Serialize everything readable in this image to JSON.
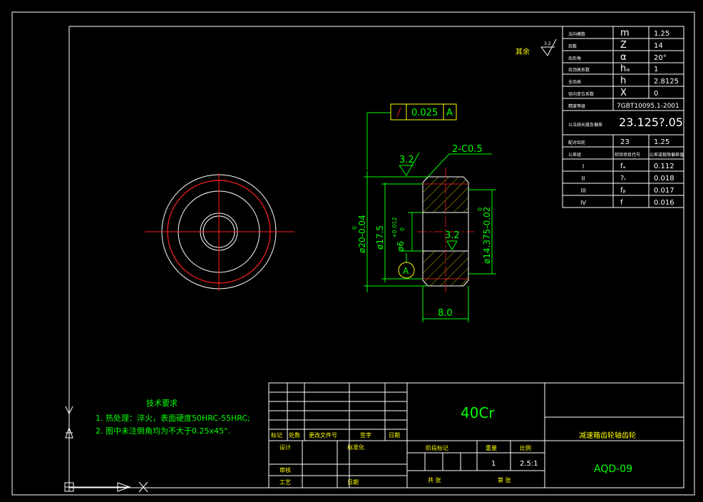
{
  "drawing": {
    "surface_note": "其余",
    "surface_symbol": "3.2",
    "runout_tolerance": "0.025",
    "runout_datum": "A",
    "chamfer_note": "2-C0.5",
    "roughness_top": "3.2",
    "roughness_bore": "3.2",
    "datum_label": "A",
    "dim_outer": "ø20-0.04",
    "dim_outer_upper": "0",
    "dim_d17": "ø17.5",
    "dim_bore": "ø6",
    "dim_bore_tol_upper": "+0.012",
    "dim_bore_tol_lower": "0",
    "dim_root": "ø14.375-0.02",
    "dim_root_upper": "0",
    "dim_width": "8.0"
  },
  "gear_params": {
    "rows": [
      {
        "name": "法向模数",
        "symbol": "m",
        "value": "1.25"
      },
      {
        "name": "齿数",
        "symbol": "Z",
        "value": "14"
      },
      {
        "name": "齿形角",
        "symbol": "α",
        "value": "20°"
      },
      {
        "name": "齿顶高系数",
        "symbol": "hₐ",
        "value": "1"
      },
      {
        "name": "全齿高",
        "symbol": "h",
        "value": "2.8125"
      },
      {
        "name": "径向变位系数",
        "symbol": "X",
        "value": "0"
      },
      {
        "name": "精度等级",
        "symbol": "",
        "value": "7GBT10095.1-2001"
      },
      {
        "name": "公法线长度及偏差",
        "symbol": "",
        "value": "23.125?.05"
      },
      {
        "name": "配对齿轮",
        "symbol": "23",
        "value": "1.25"
      },
      {
        "name": "公差组",
        "symbol": "检验项目代号",
        "value": "公差或极限偏差值"
      },
      {
        "name": "I",
        "symbol": "fₐ",
        "value": "0.112"
      },
      {
        "name": "II",
        "symbol": "?ᵣ",
        "value": "0.018"
      },
      {
        "name": "III",
        "symbol": "fᵦ",
        "value": "0.017"
      },
      {
        "name": "IV",
        "symbol": "f",
        "value": "0.016"
      }
    ]
  },
  "tech_requirements": {
    "title": "技术要求",
    "items": [
      "1. 热处理：淬火，表面硬度50HRC-55HRC;",
      "2. 图中未注倒角均为不大于0.25x45°."
    ]
  },
  "title_block": {
    "material": "40Cr",
    "part_name": "减速箱齿轮轴齿轮",
    "drawing_no": "AQD-09",
    "mark_label": "标记",
    "count_label": "处数",
    "change_doc_label": "更改文件号",
    "sign_label": "签字",
    "date_label": "日期",
    "design_label": "设计",
    "standardize_label": "标准化",
    "review_label": "审核",
    "process_label": "工艺",
    "approve_label": "日期",
    "stage_mark_label": "阶段标记",
    "weight_label": "重量",
    "scale_label": "比例",
    "weight_value": "1",
    "scale_value": "2.5:1",
    "total_sheets_label": "共  张",
    "sheet_label": "第  张"
  },
  "colors": {
    "background": "#000000",
    "line": "#ffffff",
    "center": "#ff0000",
    "dim": "#00ff00",
    "hatch": "#c8b400",
    "text": "#ffff00"
  }
}
